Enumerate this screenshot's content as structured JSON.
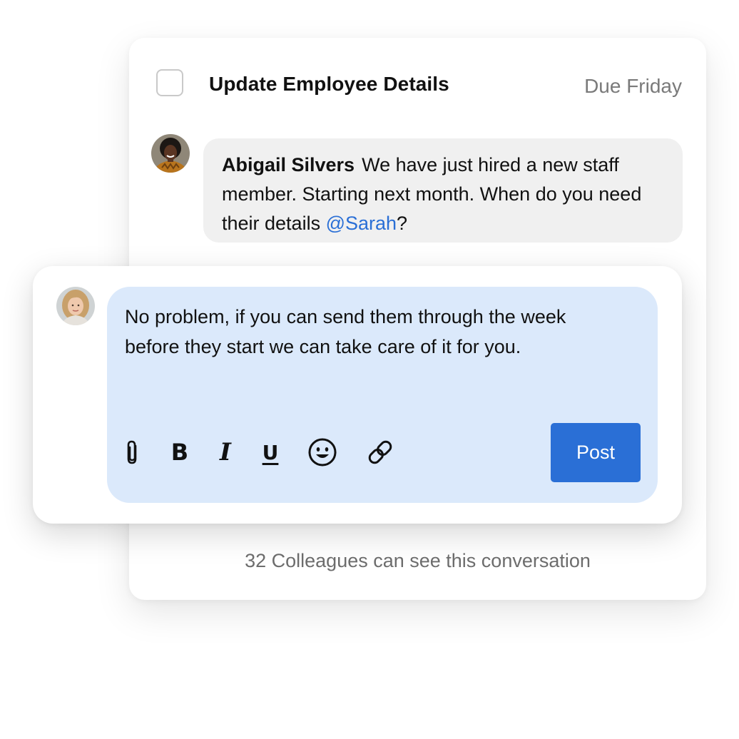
{
  "task": {
    "title": "Update Employee Details",
    "due": "Due Friday",
    "checked": false
  },
  "comment": {
    "author": "Abigail Silvers",
    "text_before_mention": "We have just hired a new staff member. Starting next month. When do you need their details ",
    "mention": "@Sarah",
    "text_after_mention": "?",
    "avatar_icon": "avatar-abigail"
  },
  "reply": {
    "text": "No problem, if you can send them through the week before they start we can take care of it for you.",
    "avatar_icon": "avatar-sarah",
    "toolbar": {
      "attach_icon": "paperclip-icon",
      "bold_label": "B",
      "italic_label": "I",
      "underline_label": "U",
      "emoji_icon": "smiley-icon",
      "link_icon": "link-icon"
    },
    "post_label": "Post"
  },
  "footer": {
    "visibility_text": "32 Colleagues can see this conversation"
  },
  "colors": {
    "accent": "#2a6fd6",
    "composer_bg": "#dbe9fb",
    "bubble_bg": "#f0f0f0",
    "muted_text": "#7a7a7a"
  }
}
